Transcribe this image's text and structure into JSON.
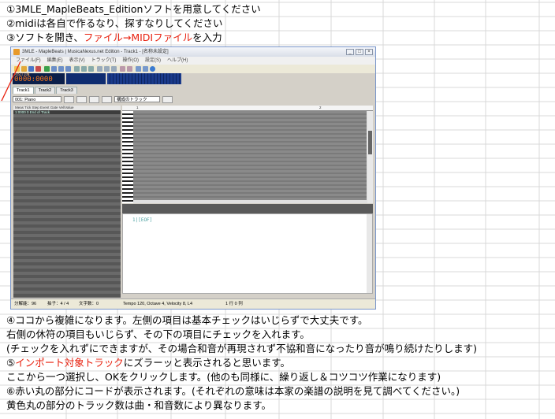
{
  "lines": {
    "l1": "①3MLE_MapleBeats_Editionソフトを用意してください",
    "l2": "②midiは各自で作るなり、探すなりしてください",
    "l3_a": "③ソフトを開き、",
    "l3_red": "ファイル→MIDIファイル",
    "l3_b": "を入力",
    "l4": "④ココから複雑になります。左側の項目は基本チェックはいじらずで大丈夫です。",
    "l5": "右側の休符の項目もいじらず、その下の項目にチェックを入れます。",
    "l6": "(チェックを入れずにできますが、その場合和音が再現されず不協和音になったり音が鳴り続けたりします)",
    "l7_a": "⑤",
    "l7_red": "インポート対象トラック",
    "l7_b": "にズラーッと表示されると思います。",
    "l8": "ここから一つ選択し、OKをクリックします。(他のも同様に、繰り返し＆コツコツ作業になります)",
    "l9": "⑥赤い丸の部分にコードが表示されます。(それぞれの意味は本家の楽譜の説明を見て調べてください。)",
    "l10": "黄色丸の部分のトラック数は曲・和音数により異なります。"
  },
  "app": {
    "title": "3MLE - MapleBeats | MusicaNexus.net Edition - Track1 - [名称未設定]",
    "menu": [
      "ファイル(F)",
      "編集(E)",
      "表示(V)",
      "トラック(T)",
      "操作(O)",
      "設定(S)",
      "ヘルプ(H)"
    ],
    "counter_label": "POSITION",
    "counter_value": "0000:0000 120",
    "tabs": [
      "Track1",
      "Track2",
      "Track3"
    ],
    "instrument": "001: Piano",
    "track_select": "構成のトラック",
    "list_header": "Meas Tick Step Event          Gate  Vel/Value",
    "list_row": "1:0000     0  End of Track",
    "ruler_1": "1",
    "ruler_2": "2",
    "eof": "1|[EOF]",
    "status_resolution": "分解能：96",
    "status_beat": "拍子：4 / 4",
    "status_chars": "文字数：0",
    "status_tempo": "Tempo 120, Octave 4, Velocity  8, L4",
    "status_pos": "1 行 0 列",
    "window_buttons": [
      "_",
      "□",
      "×"
    ]
  },
  "colors": {
    "accent_red": "#e8200e",
    "counter_bg": "#0b1f4a",
    "counter_fg": "#ff7a1a"
  }
}
